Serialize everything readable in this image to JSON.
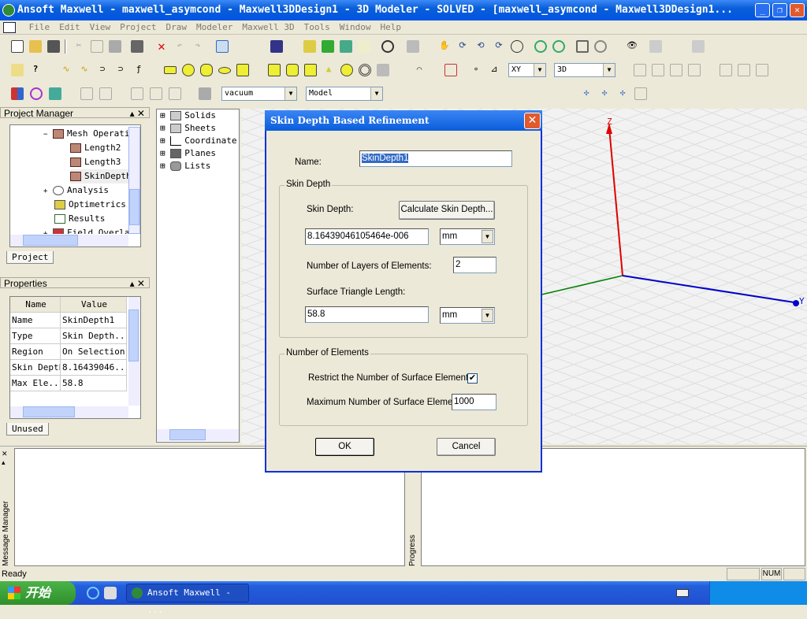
{
  "window": {
    "title": "Ansoft Maxwell - maxwell_asymcond - Maxwell3DDesign1 - 3D Modeler - SOLVED - [maxwell_asymcond - Maxwell3DDesign1..."
  },
  "menu": [
    "File",
    "Edit",
    "View",
    "Project",
    "Draw",
    "Modeler",
    "Maxwell 3D",
    "Tools",
    "Window",
    "Help"
  ],
  "toolbar": {
    "material": "vacuum",
    "mode": "Model",
    "plane": "XY",
    "view": "3D"
  },
  "project_manager": {
    "title": "Project Manager",
    "tab": "Project",
    "items": [
      {
        "label": "Mesh Operati",
        "expander": "−"
      },
      {
        "label": "Length2"
      },
      {
        "label": "Length3"
      },
      {
        "label": "SkinDepth"
      },
      {
        "label": "Analysis",
        "expander": "+"
      },
      {
        "label": "Optimetrics"
      },
      {
        "label": "Results"
      },
      {
        "label": "Field Overla",
        "expander": "+"
      }
    ]
  },
  "properties": {
    "title": "Properties",
    "tab": "Unused",
    "columns": [
      "Name",
      "Value"
    ],
    "rows": [
      [
        "Name",
        "SkinDepth1"
      ],
      [
        "Type",
        "Skin Depth..."
      ],
      [
        "Region",
        "On Selection"
      ],
      [
        "Skin Depth",
        "8.16439046..."
      ],
      [
        "Max Ele...",
        "58.8"
      ]
    ]
  },
  "model_tree": [
    "Solids",
    "Sheets",
    "Coordinate",
    "Planes",
    "Lists"
  ],
  "axes": {
    "z": "Z",
    "y": "Y",
    "colors": {
      "z": "#e00000",
      "y": "#0000c8",
      "x": "#008000"
    }
  },
  "dialog": {
    "title": "Skin Depth Based Refinement",
    "name_label": "Name:",
    "name_value": "SkinDepth1",
    "group1": "Skin Depth",
    "skin_depth_label": "Skin Depth:",
    "calc_button": "Calculate Skin Depth...",
    "skin_depth_value": "8.16439046105464e-006",
    "skin_depth_unit": "mm",
    "layers_label": "Number of Layers of Elements:",
    "layers_value": "2",
    "triangle_label": "Surface Triangle Length:",
    "triangle_value": "58.8",
    "triangle_unit": "mm",
    "group2": "Number of Elements",
    "restrict_label": "Restrict the Number of Surface Elements",
    "restrict_checked": true,
    "max_label": "Maximum Number of Surface Elements",
    "max_value": "1000",
    "ok": "OK",
    "cancel": "Cancel"
  },
  "message_manager": "Message Manager",
  "progress": "Progress",
  "status": {
    "text": "Ready",
    "num": "NUM"
  },
  "taskbar": {
    "start": "开始",
    "task": "Ansoft Maxwell - ..."
  }
}
